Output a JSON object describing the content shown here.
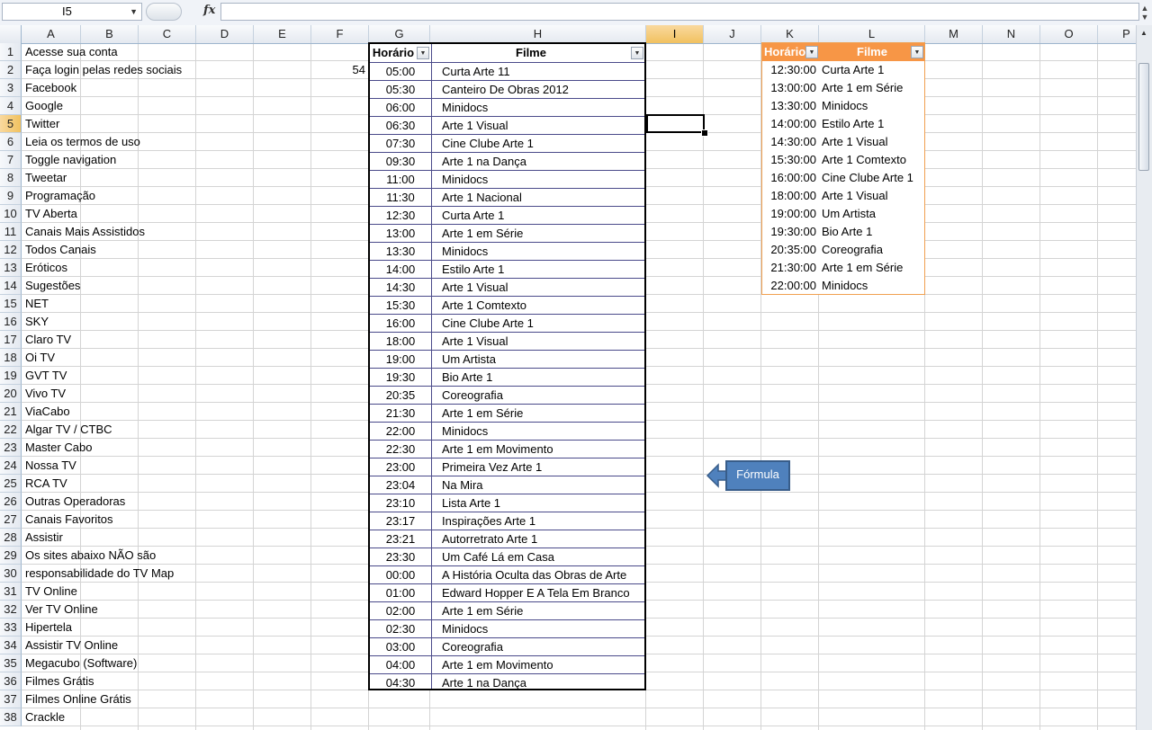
{
  "formula_bar": {
    "name_box": "I5",
    "fx_label": "fx",
    "formula": ""
  },
  "columns": [
    "A",
    "B",
    "C",
    "D",
    "E",
    "F",
    "G",
    "H",
    "I",
    "J",
    "K",
    "L",
    "M",
    "N",
    "O",
    "P"
  ],
  "selected_column": "I",
  "selected_row": "5",
  "rows": [
    "1",
    "2",
    "3",
    "4",
    "5",
    "6",
    "7",
    "8",
    "9",
    "10",
    "11",
    "12",
    "13",
    "14",
    "15",
    "16",
    "17",
    "18",
    "19",
    "20",
    "21",
    "22",
    "23",
    "24",
    "25",
    "26",
    "27",
    "28",
    "29",
    "30",
    "31",
    "32",
    "33",
    "34",
    "35",
    "36",
    "37",
    "38"
  ],
  "column_a": [
    "Acesse sua conta",
    "Faça login pelas redes sociais",
    "Facebook",
    "Google",
    "Twitter",
    "Leia os termos de uso",
    "Toggle navigation",
    "Tweetar",
    "Programação",
    "TV Aberta",
    "Canais Mais Assistidos",
    "Todos Canais",
    "Eróticos",
    "Sugestões",
    "NET",
    "SKY",
    "Claro TV",
    "Oi TV",
    "GVT TV",
    "Vivo TV",
    "ViaCabo",
    "Algar TV / CTBC",
    "Master Cabo",
    "Nossa TV",
    "RCA TV",
    "Outras Operadoras",
    "Canais Favoritos",
    "Assistir",
    "Os sites abaixo NÃO são",
    "responsabilidade do TV Map",
    "TV Online",
    "Ver TV Online",
    "Hipertela",
    "Assistir TV Online",
    "Megacubo (Software)",
    "Filmes Grátis",
    "Filmes Online Grátis",
    "Crackle"
  ],
  "f2_value": "54",
  "schedule_table": {
    "headers": {
      "time": "Horário",
      "film": "Filme"
    },
    "rows": [
      {
        "time": "05:00",
        "film": "Curta Arte 11"
      },
      {
        "time": "05:30",
        "film": "Canteiro De Obras 2012"
      },
      {
        "time": "06:00",
        "film": "Minidocs"
      },
      {
        "time": "06:30",
        "film": "Arte 1 Visual"
      },
      {
        "time": "07:30",
        "film": "Cine Clube Arte 1"
      },
      {
        "time": "09:30",
        "film": "Arte 1 na Dança"
      },
      {
        "time": "11:00",
        "film": "Minidocs"
      },
      {
        "time": "11:30",
        "film": "Arte 1 Nacional"
      },
      {
        "time": "12:30",
        "film": "Curta Arte 1"
      },
      {
        "time": "13:00",
        "film": "Arte 1 em Série"
      },
      {
        "time": "13:30",
        "film": "Minidocs"
      },
      {
        "time": "14:00",
        "film": "Estilo Arte 1"
      },
      {
        "time": "14:30",
        "film": "Arte 1 Visual"
      },
      {
        "time": "15:30",
        "film": "Arte 1 Comtexto"
      },
      {
        "time": "16:00",
        "film": "Cine Clube Arte 1"
      },
      {
        "time": "18:00",
        "film": "Arte 1 Visual"
      },
      {
        "time": "19:00",
        "film": "Um Artista"
      },
      {
        "time": "19:30",
        "film": "Bio Arte 1"
      },
      {
        "time": "20:35",
        "film": "Coreografia"
      },
      {
        "time": "21:30",
        "film": "Arte 1 em Série"
      },
      {
        "time": "22:00",
        "film": "Minidocs"
      },
      {
        "time": "22:30",
        "film": "Arte 1 em Movimento"
      },
      {
        "time": "23:00",
        "film": "Primeira Vez Arte 1"
      },
      {
        "time": "23:04",
        "film": "Na Mira"
      },
      {
        "time": "23:10",
        "film": "Lista Arte 1"
      },
      {
        "time": "23:17",
        "film": "Inspirações Arte 1"
      },
      {
        "time": "23:21",
        "film": "Autorretrato Arte 1"
      },
      {
        "time": "23:30",
        "film": "Um Café Lá em Casa"
      },
      {
        "time": "00:00",
        "film": "A História Oculta das Obras de Arte"
      },
      {
        "time": "01:00",
        "film": "Edward Hopper E A Tela Em Branco"
      },
      {
        "time": "02:00",
        "film": "Arte 1 em Série"
      },
      {
        "time": "02:30",
        "film": "Minidocs"
      },
      {
        "time": "03:00",
        "film": "Coreografia"
      },
      {
        "time": "04:00",
        "film": "Arte 1 em Movimento"
      },
      {
        "time": "04:30",
        "film": "Arte 1 na Dança"
      }
    ]
  },
  "filtered_table": {
    "headers": {
      "time": "Horário",
      "film": "Filme"
    },
    "header_color": "#f79646",
    "rows": [
      {
        "time": "12:30:00",
        "film": "Curta Arte 1"
      },
      {
        "time": "13:00:00",
        "film": "Arte 1 em Série"
      },
      {
        "time": "13:30:00",
        "film": "Minidocs"
      },
      {
        "time": "14:00:00",
        "film": "Estilo Arte 1"
      },
      {
        "time": "14:30:00",
        "film": "Arte 1 Visual"
      },
      {
        "time": "15:30:00",
        "film": "Arte 1 Comtexto"
      },
      {
        "time": "16:00:00",
        "film": "Cine Clube Arte 1"
      },
      {
        "time": "18:00:00",
        "film": "Arte 1 Visual"
      },
      {
        "time": "19:00:00",
        "film": "Um Artista"
      },
      {
        "time": "19:30:00",
        "film": "Bio Arte 1"
      },
      {
        "time": "20:35:00",
        "film": "Coreografia"
      },
      {
        "time": "21:30:00",
        "film": "Arte 1 em Série"
      },
      {
        "time": "22:00:00",
        "film": "Minidocs"
      }
    ]
  },
  "callout": {
    "label": "Fórmula",
    "color": "#4f81bd"
  }
}
